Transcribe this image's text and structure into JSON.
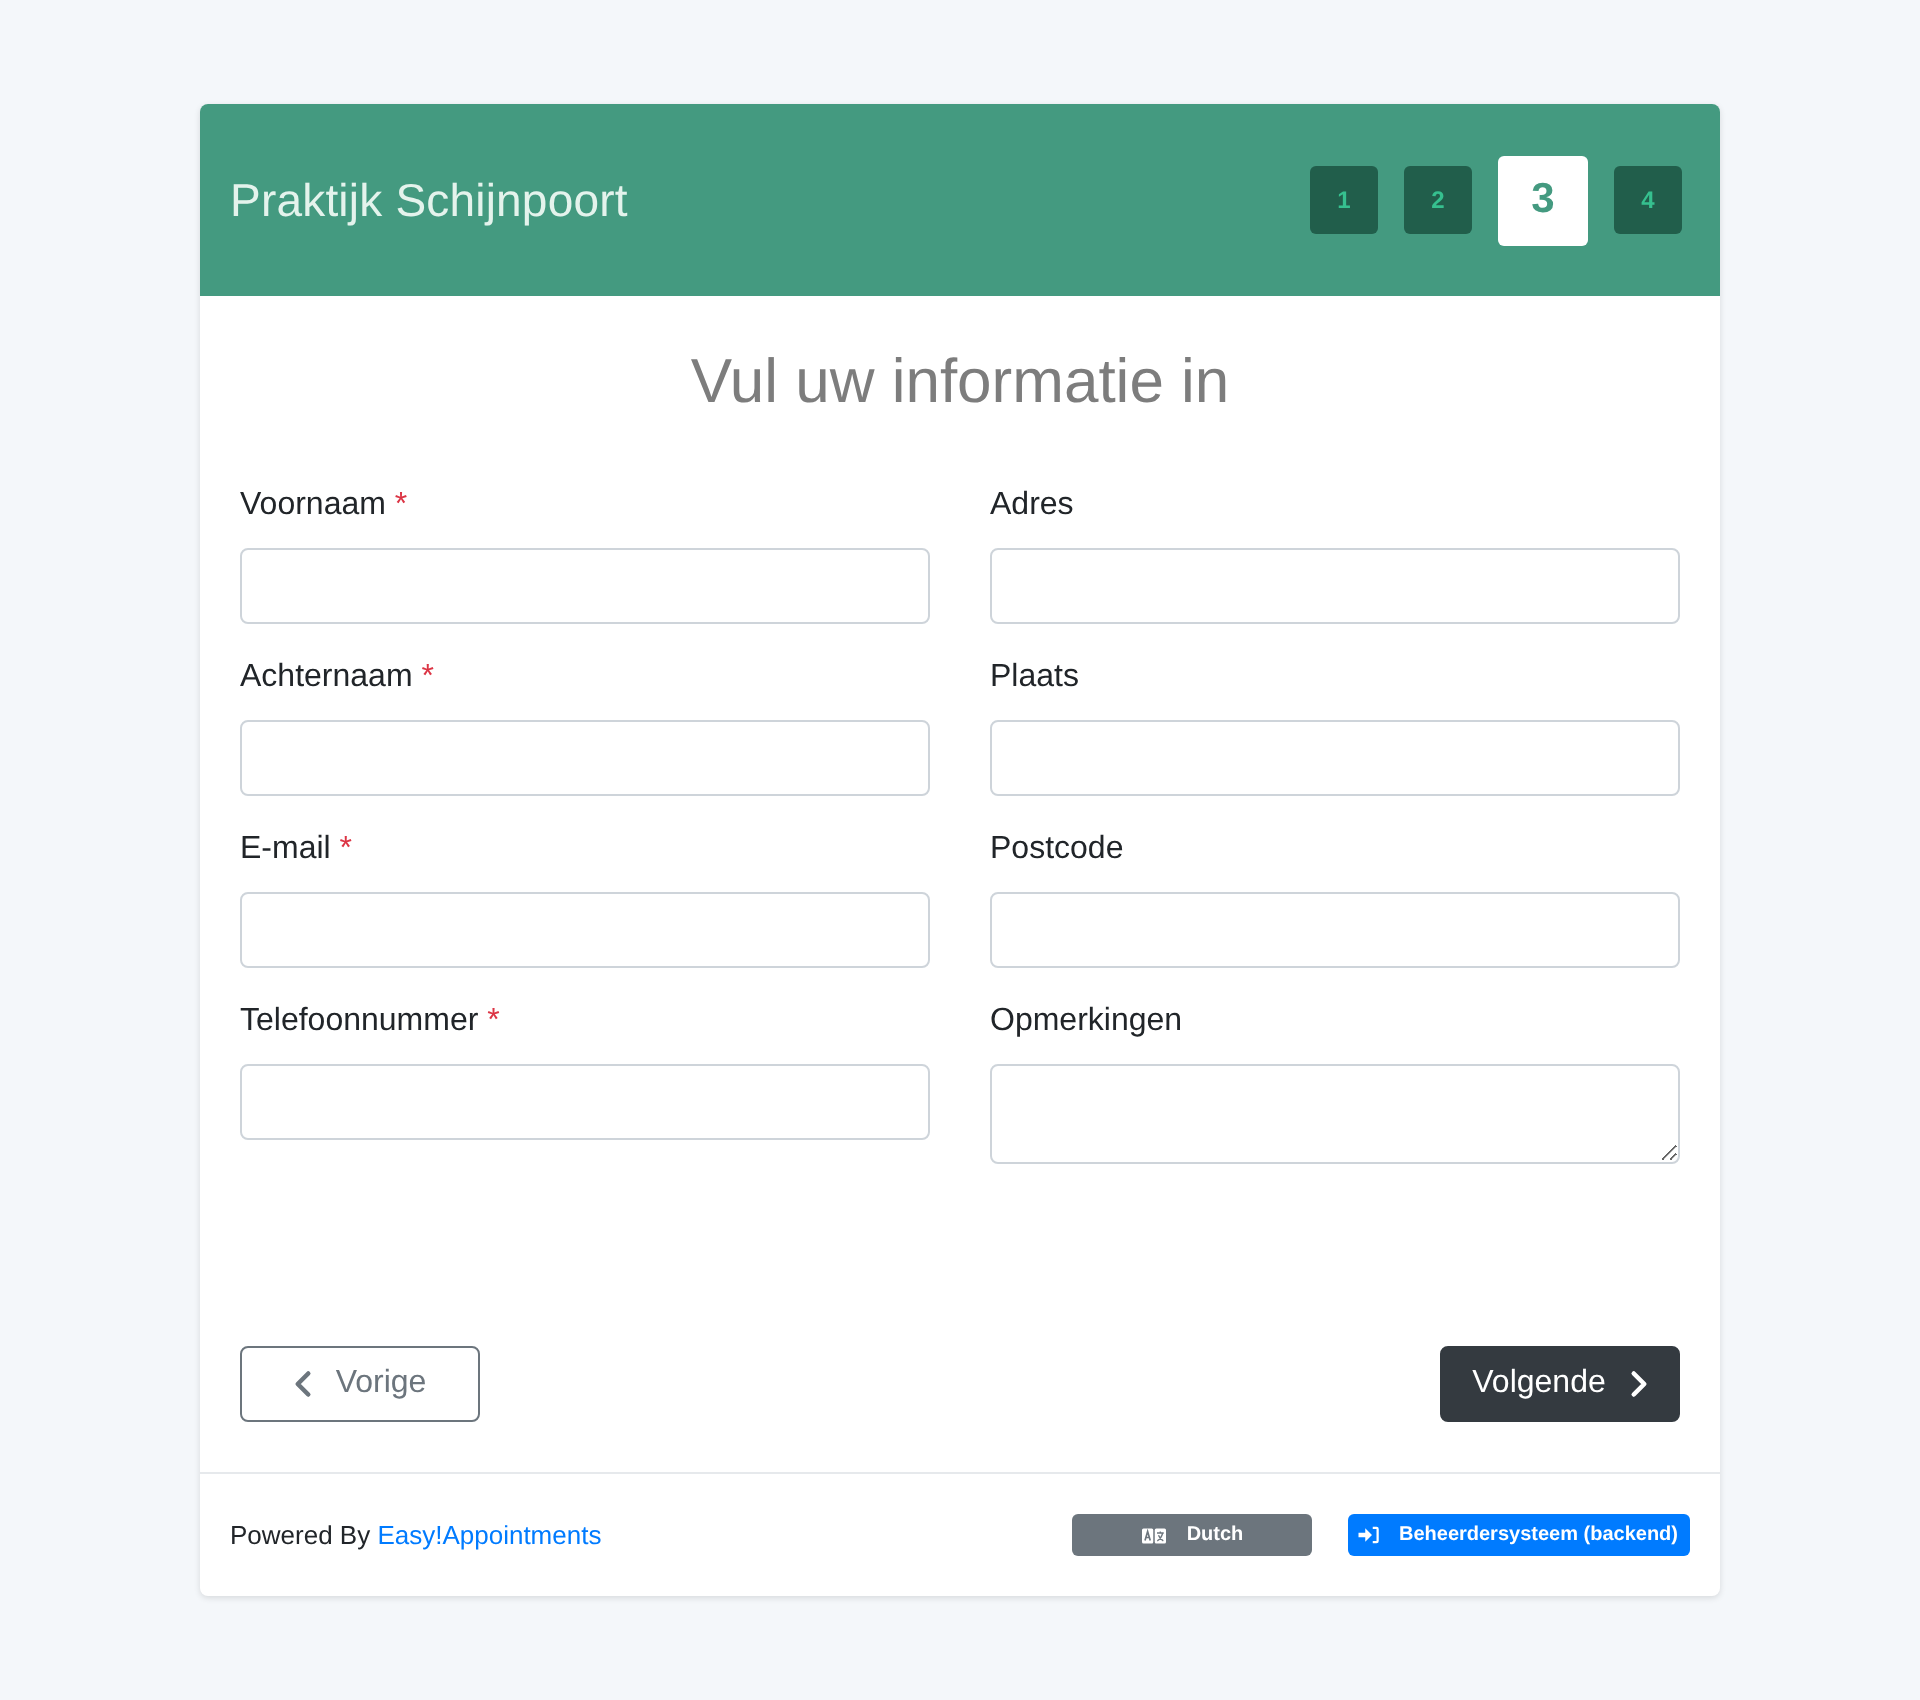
{
  "header": {
    "title": "Praktijk Schijnpoort",
    "steps": [
      {
        "label": "1",
        "selected": false
      },
      {
        "label": "2",
        "selected": false
      },
      {
        "label": "3",
        "selected": true
      },
      {
        "label": "4",
        "selected": false
      }
    ]
  },
  "form": {
    "title": "Vul uw informatie in",
    "columns": [
      [
        {
          "label": "Voornaam",
          "required_mark": "*",
          "kind": "input"
        },
        {
          "label": "Achternaam",
          "required_mark": "*",
          "kind": "input"
        },
        {
          "label": "E-mail",
          "required_mark": "*",
          "kind": "input"
        },
        {
          "label": "Telefoonnummer",
          "required_mark": "*",
          "kind": "input"
        }
      ],
      [
        {
          "label": "Adres",
          "kind": "input"
        },
        {
          "label": "Plaats",
          "kind": "input"
        },
        {
          "label": "Postcode",
          "kind": "input"
        },
        {
          "label": "Opmerkingen",
          "kind": "textarea"
        }
      ]
    ]
  },
  "navigation": {
    "back": "Vorige",
    "next": "Volgende"
  },
  "footer": {
    "powered_by": "Powered By",
    "link": "Easy!Appointments",
    "language": "Dutch",
    "backend": "Beheerdersysteem (backend)"
  }
}
